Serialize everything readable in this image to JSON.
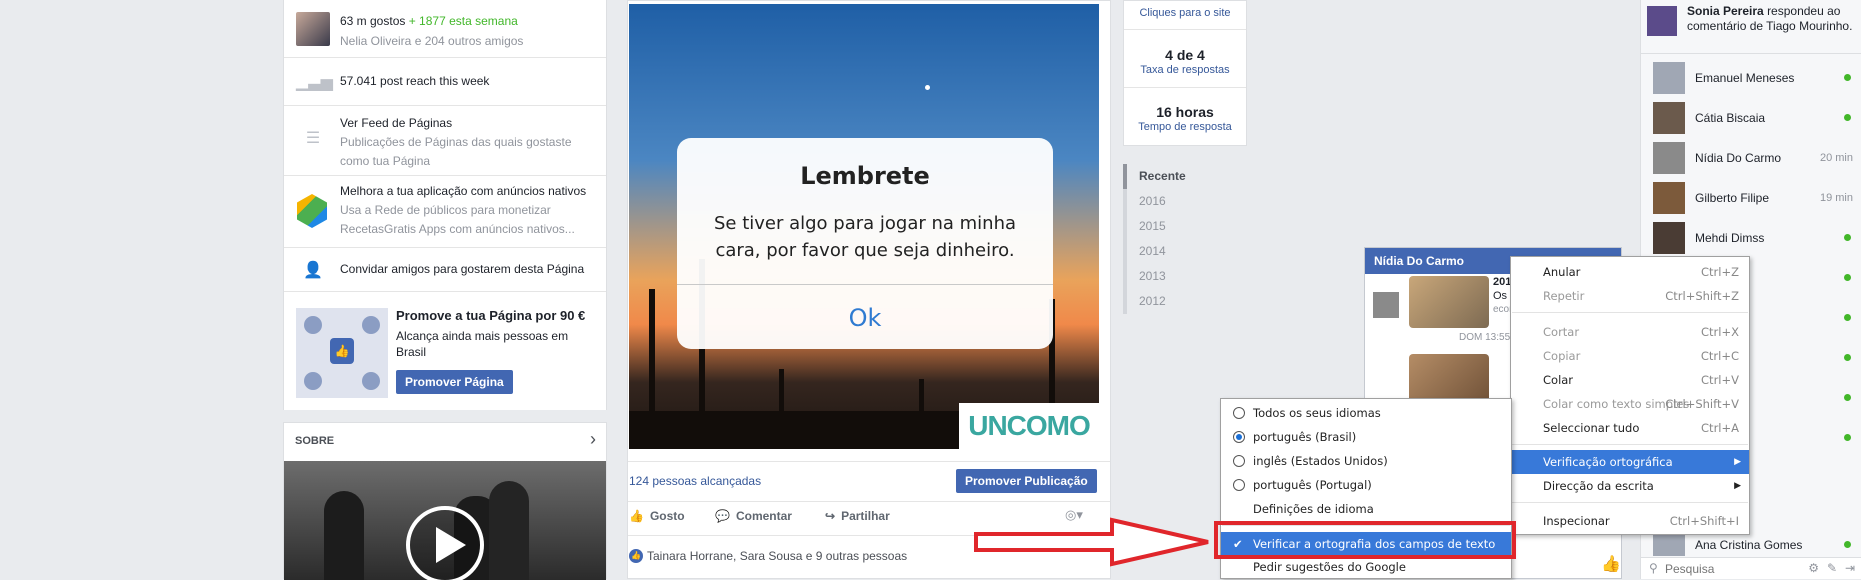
{
  "left_column": {
    "likes": {
      "count": "63 m gostos",
      "week": "+ 1877 esta semana",
      "friends": "Nelia Oliveira e 204 outros amigos"
    },
    "reach": "57.041 post reach this week",
    "pages_feed": {
      "title": "Ver Feed de Páginas",
      "desc": "Publicações de Páginas das quais gostaste como tua Página"
    },
    "native_ads": {
      "title": "Melhora a tua aplicação com anúncios nativos",
      "desc": "Usa a Rede de públicos para monetizar RecetasGratis Apps com anúncios nativos..."
    },
    "invite": "Convidar amigos para gostarem desta Página",
    "promote": {
      "title": "Promove a tua Página por 90 €",
      "desc": "Alcança ainda mais pessoas em Brasil",
      "button": "Promover Página"
    },
    "about": {
      "title": "SOBRE"
    }
  },
  "post": {
    "image_dialog": {
      "title": "Lembrete",
      "body": "Se tiver algo para jogar na minha cara, por favor que seja dinheiro.",
      "ok": "Ok"
    },
    "watermark": "UNCOMO",
    "reach": "124 pessoas alcançadas",
    "promote_button": "Promover Publicação",
    "actions": {
      "like": "Gosto",
      "comment": "Comentar",
      "share": "Partilhar"
    },
    "likers": "Tainara Horrane, Sara Sousa e 9 outras pessoas"
  },
  "stats": {
    "clicks_label": "Cliques para o site",
    "response_count": "4 de 4",
    "response_rate_label": "Taxa de respostas",
    "response_time": "16 horas",
    "response_time_label": "Tempo de resposta"
  },
  "years": [
    "Recente",
    "2016",
    "2015",
    "2014",
    "2013",
    "2012"
  ],
  "chat_sidebar": {
    "notification": {
      "name": "Sonia Pereira",
      "text": "respondeu ao comentário de Tiago Mourinho."
    },
    "contacts": [
      {
        "name": "Emanuel Meneses",
        "status": "online"
      },
      {
        "name": "Cátia Biscaia",
        "status": "online"
      },
      {
        "name": "Nídia Do Carmo",
        "status": "20 min"
      },
      {
        "name": "Gilberto Filipe",
        "status": "19 min"
      },
      {
        "name": "Mehdi Dimss",
        "status": "online"
      },
      {
        "name": "Ana Cristina Gomes",
        "status": "online"
      }
    ],
    "search_placeholder": "Pesquisa"
  },
  "chat_window": {
    "name": "Nídia Do Carmo",
    "snippet_title": "2016",
    "snippet_text": "Os e",
    "snippet_src": "econ",
    "timestamp": "DOM 13:55"
  },
  "context_menu": {
    "items": [
      {
        "label": "Anular",
        "shortcut": "Ctrl+Z",
        "disabled": false
      },
      {
        "label": "Repetir",
        "shortcut": "Ctrl+Shift+Z",
        "disabled": true
      },
      {
        "label": "Cortar",
        "shortcut": "Ctrl+X",
        "disabled": true
      },
      {
        "label": "Copiar",
        "shortcut": "Ctrl+C",
        "disabled": true
      },
      {
        "label": "Colar",
        "shortcut": "Ctrl+V",
        "disabled": false
      },
      {
        "label": "Colar como texto simples",
        "shortcut": "Ctrl+Shift+V",
        "disabled": true
      },
      {
        "label": "Seleccionar tudo",
        "shortcut": "Ctrl+A",
        "disabled": false
      },
      {
        "label": "Verificação ortográfica",
        "shortcut": "",
        "disabled": false
      },
      {
        "label": "Direcção da escrita",
        "shortcut": "",
        "disabled": false
      },
      {
        "label": "Inspecionar",
        "shortcut": "Ctrl+Shift+I",
        "disabled": false
      }
    ]
  },
  "spell_menu": {
    "items": [
      {
        "label": "Todos os seus idiomas",
        "selected": false
      },
      {
        "label": "português (Brasil)",
        "selected": true
      },
      {
        "label": "inglês (Estados Unidos)",
        "selected": false
      },
      {
        "label": "português (Portugal)",
        "selected": false
      }
    ],
    "language_settings": "Definições de idioma",
    "check_fields": "Verificar a ortografia dos campos de texto",
    "google_suggestions": "Pedir sugestões do Google"
  },
  "colors": {
    "fb_blue": "#4267b2",
    "highlight": "#3879d9",
    "annotation_red": "#e0262b"
  }
}
